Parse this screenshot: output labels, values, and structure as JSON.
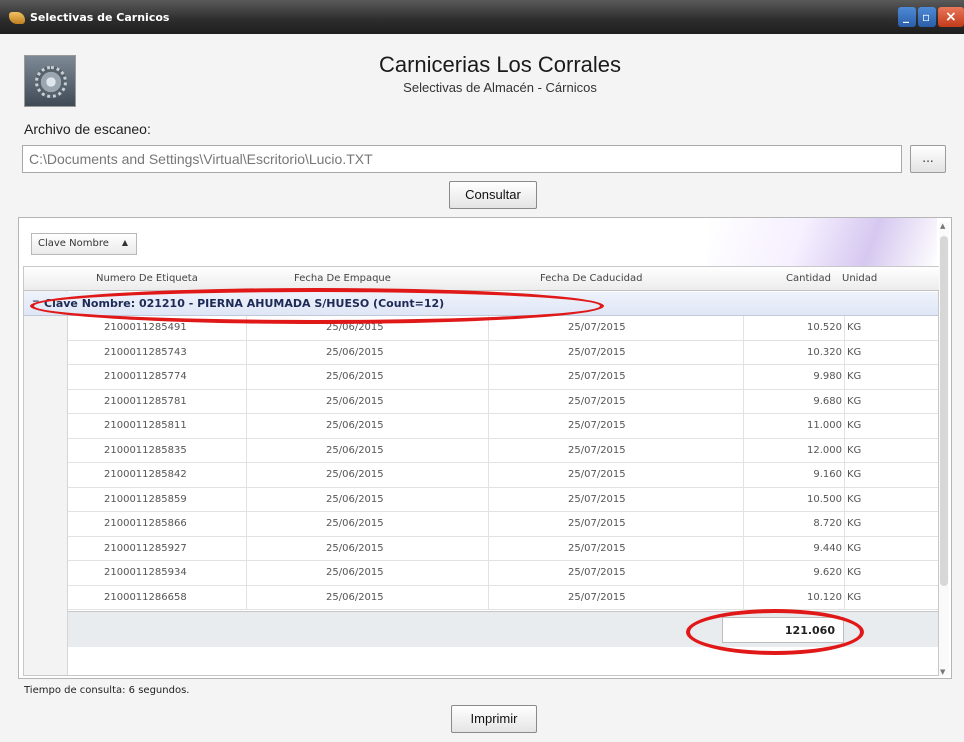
{
  "window": {
    "title": "Selectivas de Carnicos",
    "min": "_",
    "max": "▫",
    "close": "×"
  },
  "header": {
    "company": "Carnicerias Los Corrales",
    "subtitle": "Selectivas de Almacén - Cárnicos"
  },
  "file": {
    "label": "Archivo de escaneo:",
    "value": "C:\\Documents and Settings\\Virtual\\Escritorio\\Lucio.TXT",
    "browse_label": "..."
  },
  "buttons": {
    "consult": "Consultar",
    "print": "Imprimir"
  },
  "grouping": {
    "field": "Clave Nombre"
  },
  "grid": {
    "columns": [
      "Numero De Etiqueta",
      "Fecha De Empaque",
      "Fecha De Caducidad",
      "Cantidad",
      "Unidad"
    ],
    "group_label": "Clave Nombre: 021210 - PIERNA AHUMADA S/HUESO (Count=12)",
    "rows": [
      {
        "etiqueta": "2100011285491",
        "empaque": "25/06/2015",
        "caducidad": "25/07/2015",
        "cantidad": "10.520",
        "unidad": "KG"
      },
      {
        "etiqueta": "2100011285743",
        "empaque": "25/06/2015",
        "caducidad": "25/07/2015",
        "cantidad": "10.320",
        "unidad": "KG"
      },
      {
        "etiqueta": "2100011285774",
        "empaque": "25/06/2015",
        "caducidad": "25/07/2015",
        "cantidad": "9.980",
        "unidad": "KG"
      },
      {
        "etiqueta": "2100011285781",
        "empaque": "25/06/2015",
        "caducidad": "25/07/2015",
        "cantidad": "9.680",
        "unidad": "KG"
      },
      {
        "etiqueta": "2100011285811",
        "empaque": "25/06/2015",
        "caducidad": "25/07/2015",
        "cantidad": "11.000",
        "unidad": "KG"
      },
      {
        "etiqueta": "2100011285835",
        "empaque": "25/06/2015",
        "caducidad": "25/07/2015",
        "cantidad": "12.000",
        "unidad": "KG"
      },
      {
        "etiqueta": "2100011285842",
        "empaque": "25/06/2015",
        "caducidad": "25/07/2015",
        "cantidad": "9.160",
        "unidad": "KG"
      },
      {
        "etiqueta": "2100011285859",
        "empaque": "25/06/2015",
        "caducidad": "25/07/2015",
        "cantidad": "10.500",
        "unidad": "KG"
      },
      {
        "etiqueta": "2100011285866",
        "empaque": "25/06/2015",
        "caducidad": "25/07/2015",
        "cantidad": "8.720",
        "unidad": "KG"
      },
      {
        "etiqueta": "2100011285927",
        "empaque": "25/06/2015",
        "caducidad": "25/07/2015",
        "cantidad": "9.440",
        "unidad": "KG"
      },
      {
        "etiqueta": "2100011285934",
        "empaque": "25/06/2015",
        "caducidad": "25/07/2015",
        "cantidad": "9.620",
        "unidad": "KG"
      },
      {
        "etiqueta": "2100011286658",
        "empaque": "25/06/2015",
        "caducidad": "25/07/2015",
        "cantidad": "10.120",
        "unidad": "KG"
      }
    ],
    "total": "121.060"
  },
  "status": {
    "query_time": "Tiempo de consulta: 6 segundos."
  },
  "annotations": {
    "color": "#e01818"
  },
  "icons": {
    "logo": "gear-icon",
    "app": "app-icon"
  }
}
